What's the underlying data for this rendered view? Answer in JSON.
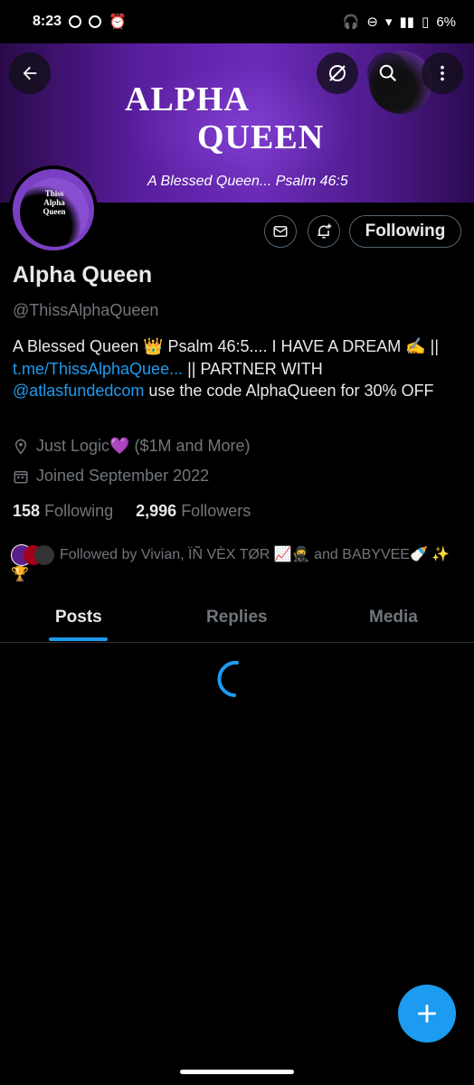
{
  "status_bar": {
    "time": "8:23",
    "battery": "6%"
  },
  "banner": {
    "title_line1": "ALPHA",
    "title_line2": "QUEEN",
    "subtitle": "A Blessed Queen... Psalm 46:5"
  },
  "avatar": {
    "label": "Thiss Alpha Queen"
  },
  "actions": {
    "following_label": "Following"
  },
  "profile": {
    "name": "Alpha Queen",
    "handle": "@ThissAlphaQueen",
    "bio_part1": "A Blessed Queen 👑 Psalm 46:5.... I HAVE A DREAM ✍️ || ",
    "bio_link": "t.me/ThissAlphaQuee...",
    "bio_part2": " || PARTNER WITH ",
    "bio_mention": "@atlasfundedcom",
    "bio_part3": " use the code AlphaQueen for 30% OFF",
    "location": "Just Logic💜 ($1M and More)",
    "joined": "Joined September 2022",
    "following_count": "158",
    "following_label": "Following",
    "followers_count": "2,996",
    "followers_label": "Followers",
    "followed_by": "Followed by Vivian, ÏÑ VÈX TØR 📈🥷 and BABYVEE🍼 ✨🏆"
  },
  "tabs": [
    {
      "label": "Posts"
    },
    {
      "label": "Replies"
    },
    {
      "label": "Media"
    }
  ],
  "colors": {
    "accent": "#1d9bf0",
    "muted": "#71767b",
    "text": "#e7e9ea",
    "background": "#000000"
  },
  "icons": [
    "back-arrow-icon",
    "grok-icon",
    "search-icon",
    "more-icon",
    "message-icon",
    "notification-bell-icon",
    "location-icon",
    "calendar-icon",
    "loading-spinner-icon",
    "plus-icon"
  ]
}
